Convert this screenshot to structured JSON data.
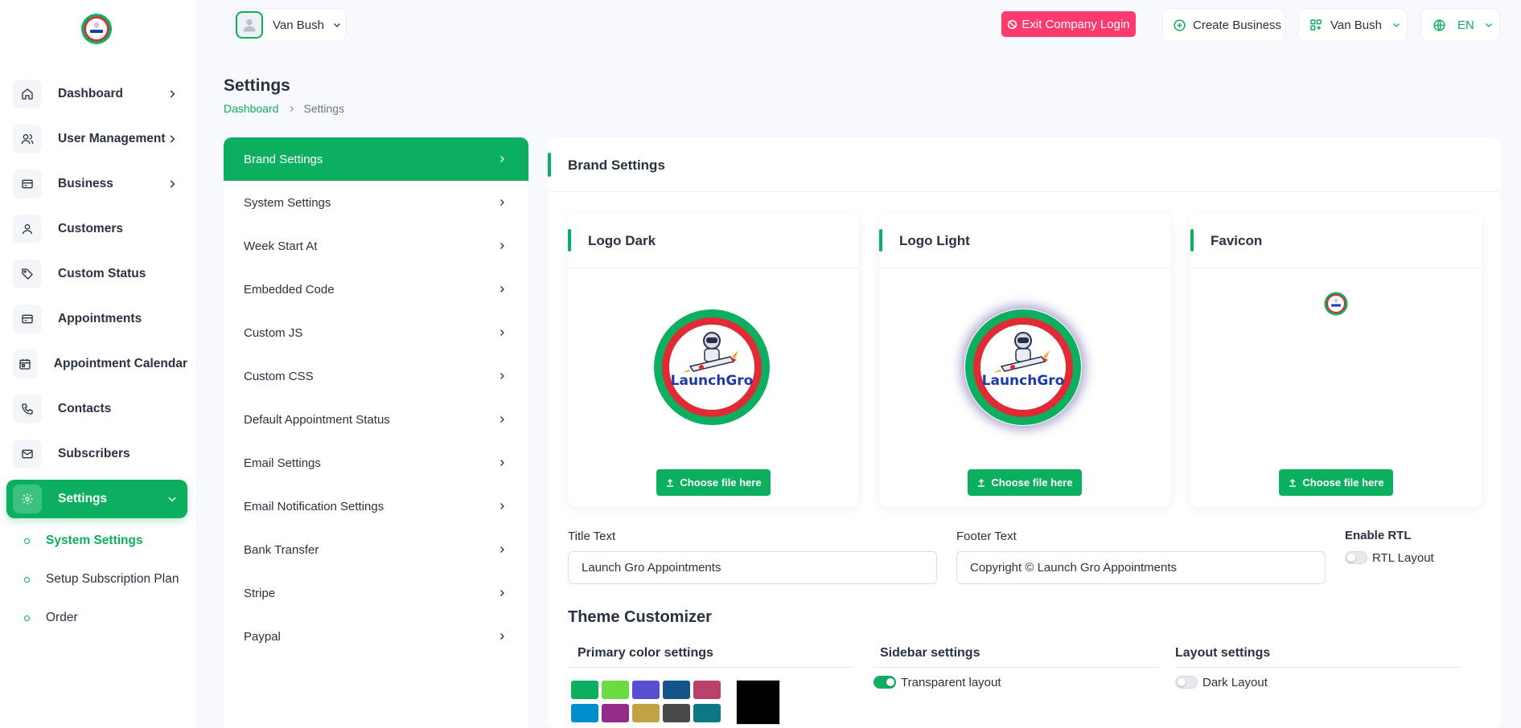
{
  "app": {
    "brand_text": "LaunchGro"
  },
  "sidebar": {
    "items": [
      {
        "label": "Dashboard",
        "icon": "home-icon",
        "has_chevron": true
      },
      {
        "label": "User Management",
        "icon": "users-icon",
        "has_chevron": true
      },
      {
        "label": "Business",
        "icon": "card-icon",
        "has_chevron": true
      },
      {
        "label": "Customers",
        "icon": "user-icon",
        "has_chevron": false
      },
      {
        "label": "Custom Status",
        "icon": "tag-icon",
        "has_chevron": false
      },
      {
        "label": "Appointments",
        "icon": "card-icon",
        "has_chevron": false
      },
      {
        "label": "Appointment Calendar",
        "icon": "calendar-icon",
        "has_chevron": false
      },
      {
        "label": "Contacts",
        "icon": "phone-icon",
        "has_chevron": false
      },
      {
        "label": "Subscribers",
        "icon": "mail-icon",
        "has_chevron": false
      },
      {
        "label": "Settings",
        "icon": "gear-icon",
        "has_chevron": true,
        "active": true
      }
    ],
    "sub_items": [
      {
        "label": "System Settings",
        "active": true
      },
      {
        "label": "Setup Subscription Plan"
      },
      {
        "label": "Order"
      }
    ]
  },
  "header": {
    "user_name": "Van Bush",
    "exit_button": "Exit Company Login",
    "create_business": "Create Business",
    "business_name": "Van Bush",
    "language": "EN"
  },
  "page": {
    "title": "Settings",
    "breadcrumb": [
      "Dashboard",
      "Settings"
    ]
  },
  "settings_menu": [
    "Brand Settings",
    "System Settings",
    "Week Start At",
    "Embedded Code",
    "Custom JS",
    "Custom CSS",
    "Default Appointment Status",
    "Email Settings",
    "Email Notification Settings",
    "Bank Transfer",
    "Stripe",
    "Paypal"
  ],
  "brand": {
    "title": "Brand Settings",
    "logo_cards": [
      {
        "title": "Logo Dark",
        "button": "Choose file here"
      },
      {
        "title": "Logo Light",
        "button": "Choose file here"
      },
      {
        "title": "Favicon",
        "button": "Choose file here"
      }
    ],
    "title_text": {
      "label": "Title Text",
      "value": "Launch Gro Appointments"
    },
    "footer_text": {
      "label": "Footer Text",
      "value": "Copyright © Launch Gro Appointments"
    },
    "rtl": {
      "label": "Enable RTL",
      "toggle_label": "RTL Layout",
      "enabled": false
    }
  },
  "theme": {
    "title": "Theme Customizer",
    "primary_color": {
      "label": "Primary color settings",
      "swatches": [
        "#0caf60",
        "#6fd943",
        "#584ed2",
        "#145388",
        "#b9406b",
        "#008ecc",
        "#922c88",
        "#c0a145",
        "#48494b",
        "#0c7785"
      ],
      "custom": "#000000"
    },
    "sidebar": {
      "label": "Sidebar settings",
      "toggle_label": "Transparent layout",
      "enabled": true
    },
    "layout": {
      "label": "Layout settings",
      "toggle_label": "Dark Layout",
      "enabled": false
    }
  },
  "colors": {
    "accent": "#0caf60",
    "danger": "#ff3a6e",
    "text": "#293240"
  }
}
